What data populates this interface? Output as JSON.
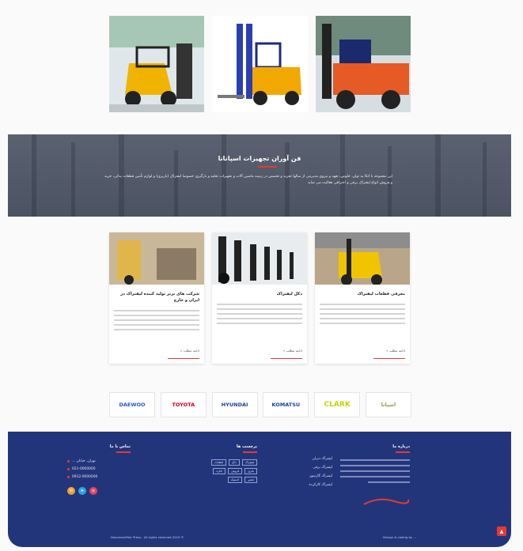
{
  "about": {
    "title": "فن آوران تجهیزات اسپانانا",
    "text": "این مجموعه با اتکا به توان، خلوص، تعهد و نیروی مدیریتی از سالها تجربه و تخصص در زمینه ماشین آلات و تجهیزات تخلیه و بارگیری خصوصا لیفتراک (باربری) و لوازم تأمین قطعات یدکی، خرید و فروش انواع لیفتراک برقی و احتراقی فعالیت می نماید"
  },
  "cards": [
    {
      "title": "معرفی قطعات لیفتراک",
      "more": "ادامه مطلب »"
    },
    {
      "title": "دکل لیفتراک",
      "more": "ادامه مطلب »"
    },
    {
      "title": "شرکت های برتر تولید کننده لیفتراک در ایران و خارج",
      "more": "ادامه مطلب »"
    }
  ],
  "brands": [
    {
      "name": "DAEWOO",
      "color": "#2a56c6"
    },
    {
      "name": "TOYOTA",
      "color": "#d0021b"
    },
    {
      "name": "HYUNDAI",
      "color": "#1c3f94"
    },
    {
      "name": "KOMATSU",
      "color": "#1b3f9a"
    },
    {
      "name": "CLARK",
      "color": "#c8d400"
    },
    {
      "name": "اسپانا",
      "color": "#8aa04a"
    }
  ],
  "footer": {
    "about_title": "درباره ما",
    "links_title": "",
    "tags_title": "برچسب ها",
    "contact_title": "تماس با ما",
    "links": [
      "لیفتراک دیزلی",
      "لیفتراک برقی",
      "لیفتراک گازسوز",
      "لیفتراک کارکرده"
    ],
    "tags": [
      "لیفتراک",
      "دکل",
      "قطعات",
      "باتری",
      "فروش",
      "اجاره",
      "تعمیر",
      "لاستیک"
    ],
    "contact": [
      "تهران، خیابان ...",
      "021-0000000",
      "0912-0000000"
    ],
    "copyright": "Dasvaranlifter Press - All rights reserved 2019 ©",
    "credit": "Design & coding by ..."
  }
}
